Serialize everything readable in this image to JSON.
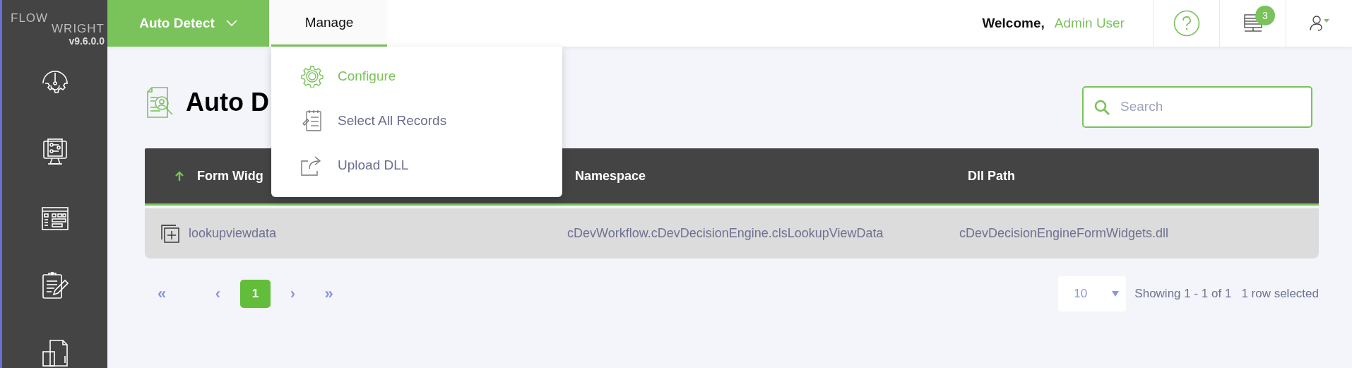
{
  "brand": {
    "logo_top": "FLOW",
    "logo_bottom": "WRIGHT",
    "version": "v9.6.0.0"
  },
  "topbar": {
    "module_button": "Auto Detect",
    "tabs": [
      {
        "label": "Manage",
        "selected": true
      }
    ],
    "welcome": "Welcome,",
    "user_name": "Admin User",
    "notification_count": "3"
  },
  "manage_menu": {
    "expanded": true,
    "items": [
      {
        "label": "Configure",
        "kind": "configure",
        "selected": true
      },
      {
        "label": "Select All Records",
        "kind": "select",
        "selected": false
      },
      {
        "label": "Upload DLL",
        "kind": "upload",
        "selected": false
      }
    ]
  },
  "page": {
    "title": "Auto D",
    "search": {
      "placeholder": "Search"
    }
  },
  "table": {
    "columns": [
      {
        "label": "Form Widg",
        "sorted": true
      },
      {
        "label": "Namespace",
        "sorted": false
      },
      {
        "label": "Dll Path",
        "sorted": false
      }
    ],
    "rows": [
      {
        "cells": [
          "lookupviewdata",
          "cDevWorkflow.cDevDecisionEngine.clsLookupViewData",
          "cDevDecisionEngineFormWidgets.dll"
        ],
        "selected": true
      }
    ]
  },
  "pagination": {
    "first": "«",
    "prev": "‹",
    "pages": [
      {
        "label": "1",
        "selected": true
      }
    ],
    "next": "›",
    "last": "»",
    "page_size": "10",
    "summary": "Showing 1 - 1 of 1",
    "selection": "1 row selected"
  }
}
